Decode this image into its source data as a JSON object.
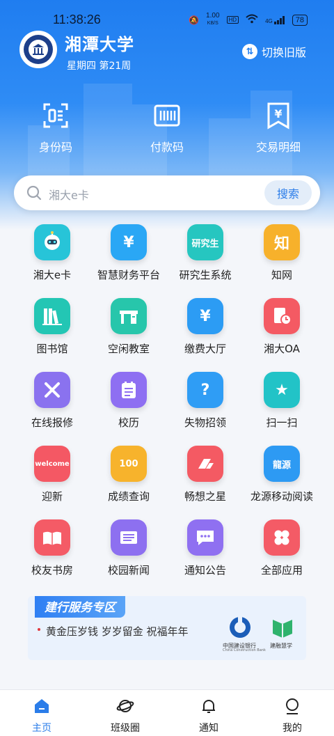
{
  "status": {
    "time": "11:38:26",
    "net_speed": "1.00",
    "net_unit": "KB/S",
    "hd": "HD",
    "net_type": "4G",
    "battery": "78"
  },
  "header": {
    "school_name": "湘潭大学",
    "week_info": "星期四 第21周",
    "switch_label": "切换旧版"
  },
  "quick_actions": [
    {
      "label": "身份码",
      "icon": "qr-id-icon"
    },
    {
      "label": "付款码",
      "icon": "barcode-icon"
    },
    {
      "label": "交易明细",
      "icon": "receipt-icon"
    }
  ],
  "search": {
    "placeholder": "湘大e卡",
    "button": "搜索"
  },
  "apps": [
    {
      "label": "湘大e卡",
      "icon": "robot-icon",
      "color": "#27c4d8",
      "glyph": ""
    },
    {
      "label": "智慧财务平台",
      "icon": "money-bag-icon",
      "color": "#2aa7f5",
      "glyph": "¥"
    },
    {
      "label": "研究生系统",
      "icon": "graduate-icon",
      "color": "#26c6c0",
      "glyph": "研究生"
    },
    {
      "label": "知网",
      "icon": "cnki-icon",
      "color": "#f7b12b",
      "glyph": "知"
    },
    {
      "label": "图书馆",
      "icon": "books-icon",
      "color": "#23c6b4",
      "glyph": ""
    },
    {
      "label": "空闲教室",
      "icon": "desk-icon",
      "color": "#27c6ab",
      "glyph": ""
    },
    {
      "label": "缴费大厅",
      "icon": "payment-icon",
      "color": "#2c9cf4",
      "glyph": "¥"
    },
    {
      "label": "湘大OA",
      "icon": "oa-clock-icon",
      "color": "#f45a63",
      "glyph": ""
    },
    {
      "label": "在线报修",
      "icon": "tools-icon",
      "color": "#8a72ef",
      "glyph": ""
    },
    {
      "label": "校历",
      "icon": "calendar-icon",
      "color": "#8e6ff2",
      "glyph": ""
    },
    {
      "label": "失物招领",
      "icon": "lost-found-icon",
      "color": "#2f9df5",
      "glyph": "?"
    },
    {
      "label": "扫一扫",
      "icon": "scan-icon",
      "color": "#22c3c7",
      "glyph": "★"
    },
    {
      "label": "迎新",
      "icon": "welcome-icon",
      "color": "#f45864",
      "glyph": "welcome"
    },
    {
      "label": "成绩查询",
      "icon": "grades-icon",
      "color": "#f7b32c",
      "glyph": "100"
    },
    {
      "label": "畅想之星",
      "icon": "star-logo-icon",
      "color": "#f45a63",
      "glyph": ""
    },
    {
      "label": "龙源移动阅读",
      "icon": "longyuan-icon",
      "color": "#2d9af3",
      "glyph": "龍源"
    },
    {
      "label": "校友书房",
      "icon": "open-book-icon",
      "color": "#f45b66",
      "glyph": ""
    },
    {
      "label": "校园新闻",
      "icon": "news-icon",
      "color": "#8d70f0",
      "glyph": ""
    },
    {
      "label": "通知公告",
      "icon": "chat-icon",
      "color": "#8f70f1",
      "glyph": ""
    },
    {
      "label": "全部应用",
      "icon": "apps-grid-icon",
      "color": "#f45b66",
      "glyph": ""
    }
  ],
  "banner": {
    "title": "建行服务专区",
    "text": "黄金压岁钱 岁岁留金 祝福年年",
    "bank_name": "中国建设银行",
    "bank_en": "China Construction Bank",
    "partner": "建融慧学"
  },
  "tabs": [
    {
      "label": "主页",
      "icon": "home-icon",
      "active": true
    },
    {
      "label": "班级圈",
      "icon": "planet-icon",
      "active": false
    },
    {
      "label": "通知",
      "icon": "bell-icon",
      "active": false
    },
    {
      "label": "我的",
      "icon": "user-icon",
      "active": false
    }
  ],
  "colors": {
    "primary": "#1f7df0",
    "active_tab": "#2b7de9"
  }
}
